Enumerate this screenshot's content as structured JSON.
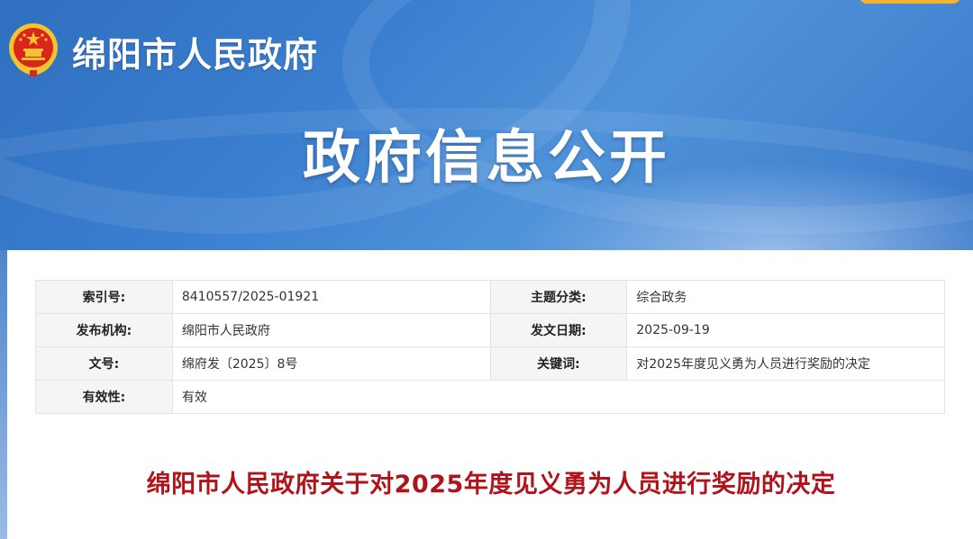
{
  "header": {
    "site_name": "绵阳市人民政府",
    "banner_title": "政府信息公开",
    "emblem_icon": "national-emblem-icon",
    "colors": {
      "banner": "#3b7fd0",
      "accent_button": "#f2b233"
    }
  },
  "meta": {
    "index_no_label": "索引号:",
    "index_no_value": "8410557/2025-01921",
    "topic_label": "主题分类:",
    "topic_value": "综合政务",
    "publisher_label": "发布机构:",
    "publisher_value": "绵阳市人民政府",
    "date_label": "发文日期:",
    "date_value": "2025-09-19",
    "doc_no_label": "文号:",
    "doc_no_value": "绵府发〔2025〕8号",
    "keywords_label": "关键词:",
    "keywords_value": "对2025年度见义勇为人员进行奖励的决定",
    "validity_label": "有效性:",
    "validity_value": "有效"
  },
  "document": {
    "title": "绵阳市人民政府关于对2025年度见义勇为人员进行奖励的决定",
    "title_color": "#b0141b"
  }
}
